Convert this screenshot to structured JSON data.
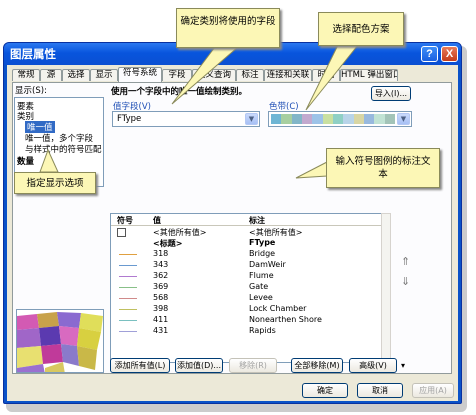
{
  "window": {
    "title": "图层属性",
    "help_label": "?",
    "close_label": "X"
  },
  "tabs": [
    "常规",
    "源",
    "选择",
    "显示",
    "符号系统",
    "字段",
    "定义查询",
    "标注",
    "连接和关联",
    "时间",
    "HTML 弹出窗口"
  ],
  "show_label": "显示(S):",
  "tree": {
    "items": [
      "要素",
      "类别",
      "唯一值",
      "唯一值，多个字段",
      "与样式中的符号匹配",
      "数量"
    ],
    "selected_index": 2
  },
  "heading": "使用一个字段中的唯一值绘制类别。",
  "import_button": "导入(I)...",
  "value_field": {
    "label": "值字段(V)",
    "value": "FType"
  },
  "color_ramp_label": "色带(C)",
  "color_ramp_colors": [
    "#6fb6d4",
    "#a7cfa0",
    "#82b6c8",
    "#c2a9cf",
    "#9dc3e8",
    "#c9e0a1",
    "#8fd0c5",
    "#b8d4e9",
    "#d8d6a4",
    "#98b9de",
    "#c1e3d4",
    "#a3c4b8"
  ],
  "table": {
    "headers": [
      "符号",
      "值",
      "标注"
    ],
    "rows": [
      {
        "value": "<其他所有值>",
        "label": "<其他所有值>",
        "bold": false,
        "checkbox": true
      },
      {
        "value": "<标题>",
        "label": "FType",
        "bold": true,
        "checkbox": false
      },
      {
        "value": "318",
        "label": "Bridge"
      },
      {
        "value": "343",
        "label": "DamWeir"
      },
      {
        "value": "362",
        "label": "Flume"
      },
      {
        "value": "369",
        "label": "Gate"
      },
      {
        "value": "568",
        "label": "Levee"
      },
      {
        "value": "398",
        "label": "Lock Chamber"
      },
      {
        "value": "411",
        "label": "Nonearthen Shore"
      },
      {
        "value": "431",
        "label": "Rapids"
      }
    ],
    "symbol_colors": [
      "#9a9a9a",
      "#fff",
      "#e0a040",
      "#6a9ad0",
      "#b07ad0",
      "#88c088",
      "#d08a8a",
      "#c0c060",
      "#7ac0c0",
      "#a0a0d8"
    ]
  },
  "side_arrows": [
    "⇑",
    "⇓"
  ],
  "bottom_buttons": [
    "添加所有值(L)",
    "添加值(D)...",
    "移除(R)",
    "全部移除(M)",
    "高级(V)"
  ],
  "advanced_arrow": "▾",
  "dialog_buttons": [
    "确定",
    "取消",
    "应用(A)"
  ],
  "callouts": {
    "field": "确定类别将使用的字段",
    "color": "选择配色方案",
    "display": "指定显示选项",
    "label": "输入符号图例的标注文本"
  }
}
